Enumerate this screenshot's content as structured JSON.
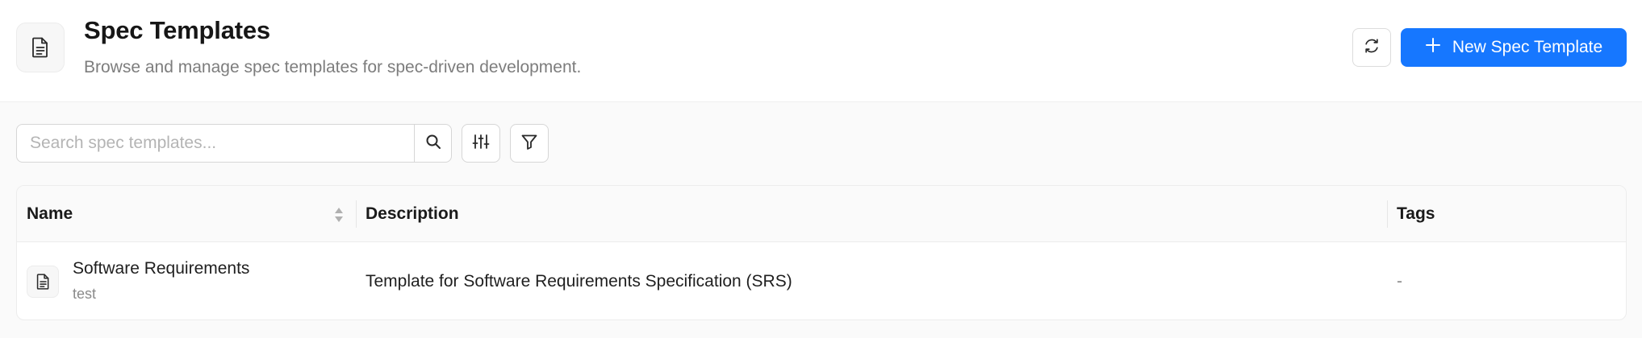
{
  "header": {
    "title": "Spec Templates",
    "subtitle": "Browse and manage spec templates for spec-driven development.",
    "icon": "document-icon",
    "refresh_icon": "refresh-icon",
    "new_button_label": "New Spec Template",
    "accent_color": "#1677ff"
  },
  "toolbar": {
    "search_placeholder": "Search spec templates...",
    "search_value": "",
    "search_icon": "search-icon",
    "columns_icon": "sliders-icon",
    "filter_icon": "filter-icon"
  },
  "table": {
    "columns": [
      "Name",
      "Description",
      "Tags"
    ],
    "rows": [
      {
        "name": "Software Requirements",
        "subtitle": "test",
        "description": "Template for Software Requirements Specification (SRS)",
        "tags": "-",
        "icon": "document-icon"
      }
    ]
  }
}
